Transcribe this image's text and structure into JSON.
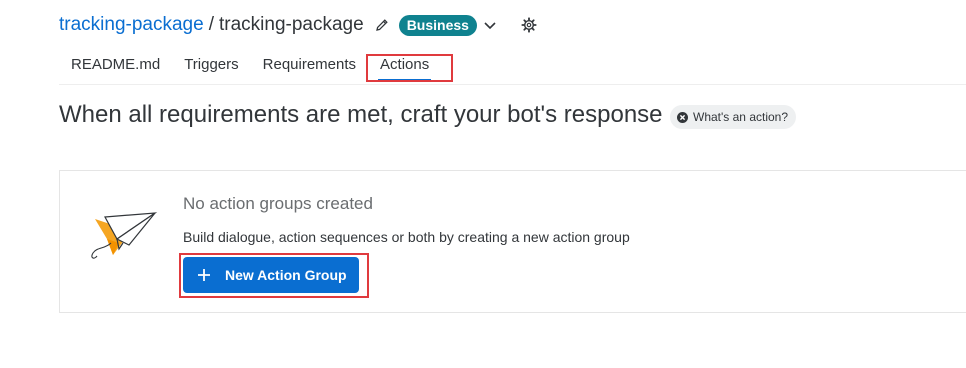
{
  "header": {
    "project_link": "tracking-package",
    "separator": "/",
    "current": "tracking-package",
    "badge": "Business",
    "edit_icon": "pencil-icon",
    "dropdown_icon": "chevron-down-icon",
    "settings_icon": "gear-icon"
  },
  "tabs": [
    {
      "label": "README.md"
    },
    {
      "label": "Triggers"
    },
    {
      "label": "Requirements"
    },
    {
      "label": "Actions",
      "active": true
    }
  ],
  "main": {
    "heading": "When all requirements are met, craft your bot's response",
    "help_label": "What's an action?",
    "help_icon": "x-circle-icon"
  },
  "empty_state": {
    "illustration": "paper-plane-icon",
    "title": "No action groups created",
    "description": "Build dialogue, action sequences or both by creating a new action group",
    "button_label": "New Action Group",
    "button_icon": "plus-icon"
  },
  "colors": {
    "accent": "#0a6ed1",
    "badge": "#0f828f",
    "highlight": "#e03a3e",
    "illustration_orange": "#f5a623"
  }
}
